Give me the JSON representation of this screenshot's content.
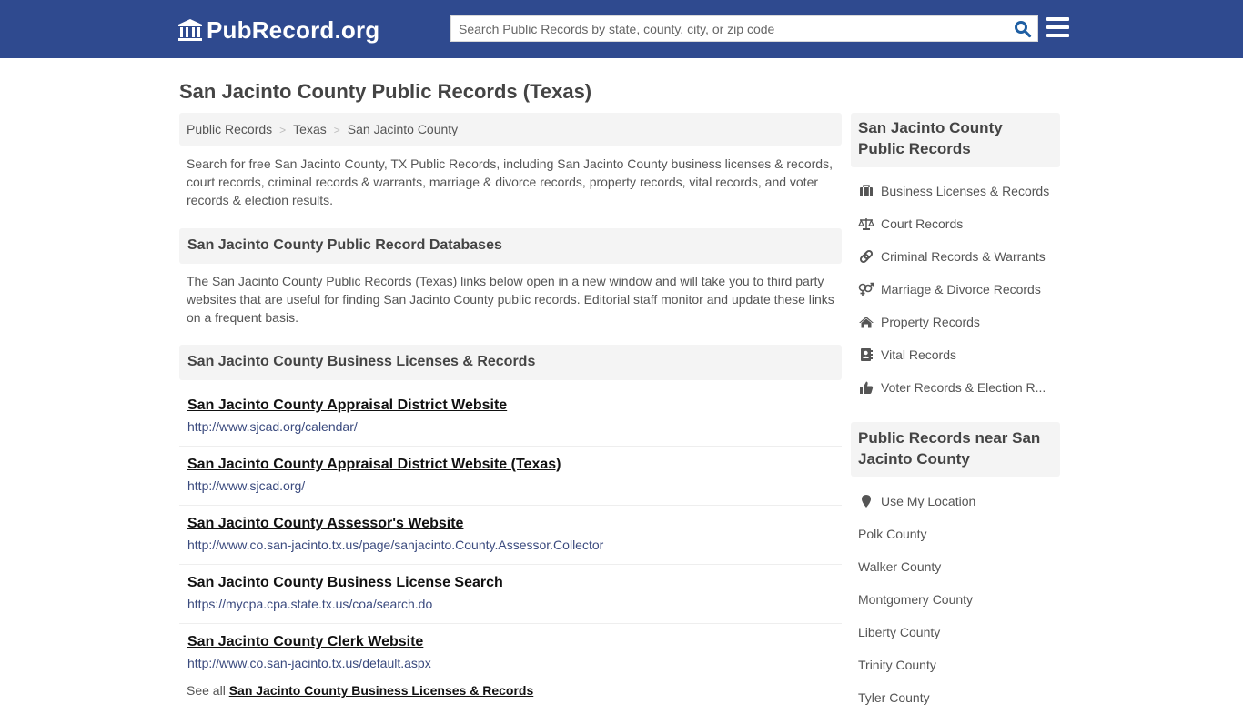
{
  "header": {
    "logo_text": "PubRecord.org",
    "search_placeholder": "Search Public Records by state, county, city, or zip code",
    "search_value": "",
    "colors": {
      "bar": "#2f4a8f",
      "search_icon": "#1f5fa3"
    }
  },
  "page": {
    "title": "San Jacinto County Public Records (Texas)",
    "breadcrumb": [
      "Public Records",
      "Texas",
      "San Jacinto County"
    ],
    "intro": "Search for free San Jacinto County, TX Public Records, including San Jacinto County business licenses & records, court records, criminal records & warrants, marriage & divorce records, property records, vital records, and voter records & election results.",
    "databases_heading": "San Jacinto County Public Record Databases",
    "databases_desc": "The San Jacinto County Public Records (Texas) links below open in a new window and will take you to third party websites that are useful for finding San Jacinto County public records. Editorial staff monitor and update these links on a frequent basis.",
    "business_heading": "San Jacinto County Business Licenses & Records",
    "business_links": [
      {
        "title": "San Jacinto County Appraisal District Website",
        "url": "http://www.sjcad.org/calendar/"
      },
      {
        "title": "San Jacinto County Appraisal District Website (Texas)",
        "url": "http://www.sjcad.org/"
      },
      {
        "title": "San Jacinto County Assessor's Website",
        "url": "http://www.co.san-jacinto.tx.us/page/sanjacinto.County.Assessor.Collector"
      },
      {
        "title": "San Jacinto County Business License Search",
        "url": "https://mycpa.cpa.state.tx.us/coa/search.do"
      },
      {
        "title": "San Jacinto County Clerk Website",
        "url": "http://www.co.san-jacinto.tx.us/default.aspx"
      }
    ],
    "see_all_prefix": "See all",
    "see_all_link": "San Jacinto County Business Licenses & Records"
  },
  "sidebar": {
    "records_heading": "San Jacinto County Public Records",
    "records_items": [
      {
        "icon": "briefcase-icon",
        "label": "Business Licenses & Records"
      },
      {
        "icon": "scales-icon",
        "label": "Court Records"
      },
      {
        "icon": "link-icon",
        "label": "Criminal Records & Warrants"
      },
      {
        "icon": "gender-icon",
        "label": "Marriage & Divorce Records"
      },
      {
        "icon": "home-icon",
        "label": "Property Records"
      },
      {
        "icon": "address-book-icon",
        "label": "Vital Records"
      },
      {
        "icon": "thumbs-up-icon",
        "label": "Voter Records & Election R..."
      }
    ],
    "nearby_heading": "Public Records near San Jacinto County",
    "use_location": "Use My Location",
    "nearby_counties": [
      "Polk County",
      "Walker County",
      "Montgomery County",
      "Liberty County",
      "Trinity County",
      "Tyler County"
    ]
  }
}
